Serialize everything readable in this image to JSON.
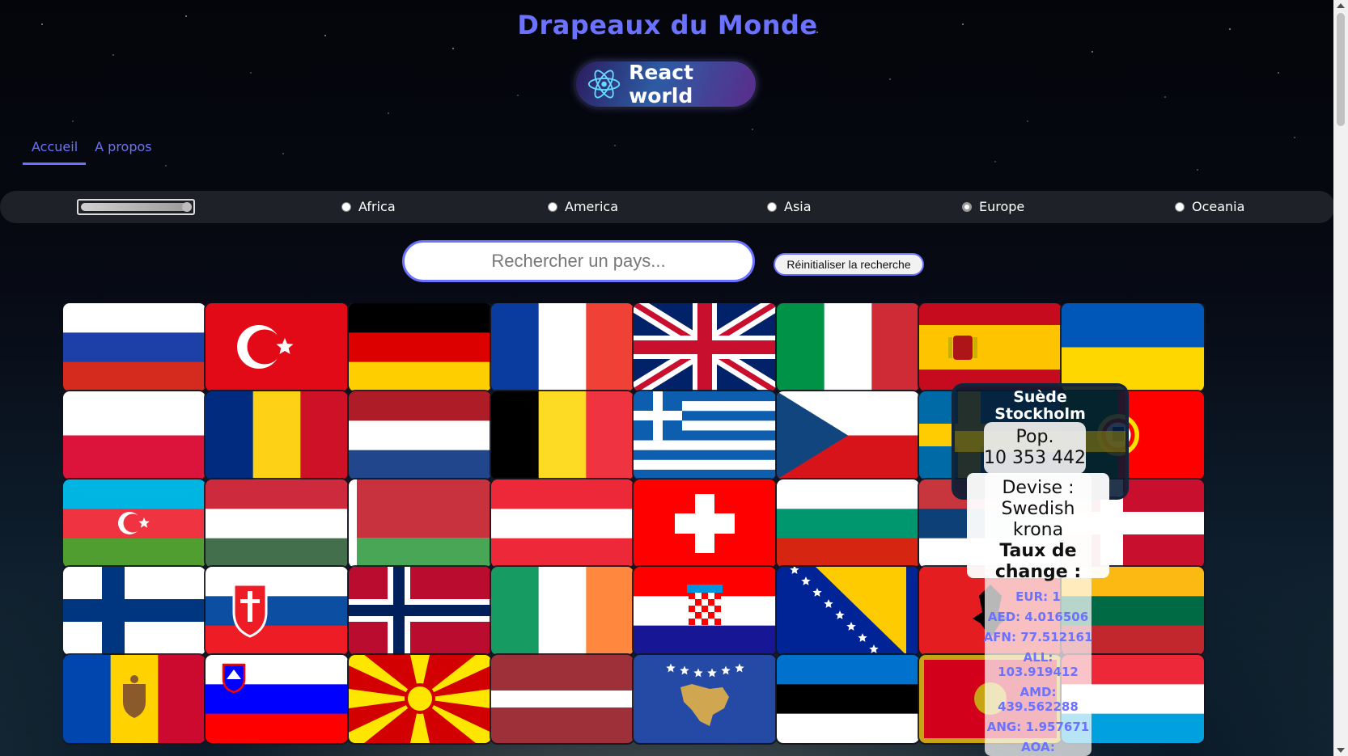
{
  "header": {
    "title": "Drapeaux du Monde",
    "logo_text": "React world"
  },
  "nav": {
    "items": [
      {
        "label": "Accueil",
        "active": true
      },
      {
        "label": "A propos",
        "active": false
      }
    ]
  },
  "filters": {
    "range_value": 1.0,
    "continents": [
      {
        "label": "Africa",
        "checked": false
      },
      {
        "label": "America",
        "checked": false
      },
      {
        "label": "Asia",
        "checked": false
      },
      {
        "label": "Europe",
        "checked": true
      },
      {
        "label": "Oceania",
        "checked": false
      }
    ]
  },
  "search": {
    "placeholder": "Rechercher un pays...",
    "value": "",
    "reset_label": "Réinitialiser la recherche"
  },
  "flags": [
    {
      "id": "russia",
      "name": "Russie",
      "icon": "russia-flag-icon"
    },
    {
      "id": "turkey",
      "name": "Turquie",
      "icon": "turkey-flag-icon"
    },
    {
      "id": "germany",
      "name": "Allemagne",
      "icon": "germany-flag-icon"
    },
    {
      "id": "france",
      "name": "France",
      "icon": "france-flag-icon"
    },
    {
      "id": "uk",
      "name": "Royaume-Uni",
      "icon": "uk-flag-icon"
    },
    {
      "id": "italy",
      "name": "Italie",
      "icon": "italy-flag-icon"
    },
    {
      "id": "spain",
      "name": "Espagne",
      "icon": "spain-flag-icon"
    },
    {
      "id": "ukraine",
      "name": "Ukraine",
      "icon": "ukraine-flag-icon"
    },
    {
      "id": "poland",
      "name": "Pologne",
      "icon": "poland-flag-icon"
    },
    {
      "id": "romania",
      "name": "Roumanie",
      "icon": "romania-flag-icon"
    },
    {
      "id": "netherlands",
      "name": "Pays-Bas",
      "icon": "netherlands-flag-icon"
    },
    {
      "id": "belgium",
      "name": "Belgique",
      "icon": "belgium-flag-icon"
    },
    {
      "id": "greece",
      "name": "Grèce",
      "icon": "greece-flag-icon"
    },
    {
      "id": "czechia",
      "name": "Tchéquie",
      "icon": "czechia-flag-icon"
    },
    {
      "id": "sweden",
      "name": "Suède",
      "icon": "sweden-flag-icon"
    },
    {
      "id": "portugal",
      "name": "Portugal",
      "icon": "portugal-flag-icon"
    },
    {
      "id": "azerbaijan",
      "name": "Azerbaïdjan",
      "icon": "azerbaijan-flag-icon"
    },
    {
      "id": "hungary",
      "name": "Hongrie",
      "icon": "hungary-flag-icon"
    },
    {
      "id": "belarus",
      "name": "Biélorussie",
      "icon": "belarus-flag-icon"
    },
    {
      "id": "austria",
      "name": "Autriche",
      "icon": "austria-flag-icon"
    },
    {
      "id": "switzerland",
      "name": "Suisse",
      "icon": "switzerland-flag-icon"
    },
    {
      "id": "bulgaria",
      "name": "Bulgarie",
      "icon": "bulgaria-flag-icon"
    },
    {
      "id": "serbia",
      "name": "Serbie",
      "icon": "serbia-flag-icon"
    },
    {
      "id": "denmark",
      "name": "Danemark",
      "icon": "denmark-flag-icon"
    },
    {
      "id": "finland",
      "name": "Finlande",
      "icon": "finland-flag-icon"
    },
    {
      "id": "slovakia",
      "name": "Slovaquie",
      "icon": "slovakia-flag-icon"
    },
    {
      "id": "norway",
      "name": "Norvège",
      "icon": "norway-flag-icon"
    },
    {
      "id": "ireland",
      "name": "Irlande",
      "icon": "ireland-flag-icon"
    },
    {
      "id": "croatia",
      "name": "Croatie",
      "icon": "croatia-flag-icon"
    },
    {
      "id": "bosnia",
      "name": "Bosnie-Herzégovine",
      "icon": "bosnia-flag-icon"
    },
    {
      "id": "albania",
      "name": "Albanie",
      "icon": "albania-flag-icon"
    },
    {
      "id": "lithuania",
      "name": "Lituanie",
      "icon": "lithuania-flag-icon"
    },
    {
      "id": "moldova",
      "name": "Moldavie",
      "icon": "moldova-flag-icon"
    },
    {
      "id": "slovenia",
      "name": "Slovénie",
      "icon": "slovenia-flag-icon"
    },
    {
      "id": "northmacedonia",
      "name": "Macédoine du Nord",
      "icon": "north-macedonia-flag-icon"
    },
    {
      "id": "latvia",
      "name": "Lettonie",
      "icon": "latvia-flag-icon"
    },
    {
      "id": "kosovo",
      "name": "Kosovo",
      "icon": "kosovo-flag-icon"
    },
    {
      "id": "estonia",
      "name": "Estonie",
      "icon": "estonia-flag-icon"
    },
    {
      "id": "montenegro",
      "name": "Monténégro",
      "icon": "montenegro-flag-icon"
    },
    {
      "id": "luxembourg",
      "name": "Luxembourg",
      "icon": "luxembourg-flag-icon"
    }
  ],
  "hover_card": {
    "name": "Suède",
    "capital": "Stockholm",
    "population_label": "Pop.",
    "population": "10 353 442",
    "currency_label": "Devise :",
    "currency": "Swedish krona",
    "rates_label": "Taux de change :",
    "rates": [
      "EUR: 1",
      "AED: 4.016506",
      "AFN: 77.512161",
      "ALL: 103.919412",
      "AMD: 439.562288",
      "ANG: 1.957671",
      "AOA:"
    ]
  }
}
